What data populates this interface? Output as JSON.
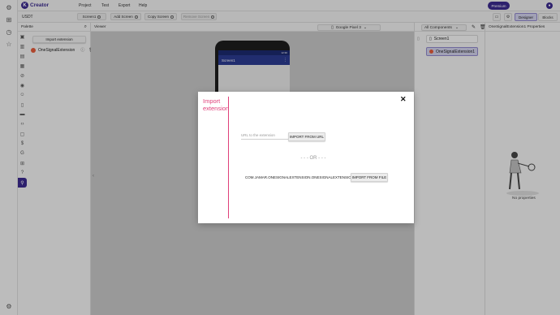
{
  "app": {
    "brand": "Creator",
    "logo_letter": "K",
    "accent": "#3a2a8c"
  },
  "menu": [
    "Project",
    "Test",
    "Export",
    "Help"
  ],
  "premium_label": "Premium",
  "project_name": "USDT",
  "toolbar": {
    "screen_select": "Screen1",
    "add_screen": "Add Screen",
    "copy_screen": "Copy Screen",
    "remove_screen": "Remove Screen",
    "designer": "Designer",
    "blocks": "Blocks"
  },
  "palette": {
    "title": "Palette",
    "import_button": "Import extension",
    "extension_item": "OneSignalExtension"
  },
  "viewer": {
    "title": "Viewer",
    "device": "Google Pixel 3",
    "screen_title": "Screen1",
    "status_time": "12:30"
  },
  "components": {
    "selector": "All Components",
    "items": [
      "Screen1",
      "OneSignalExtension1"
    ]
  },
  "properties": {
    "title": "OneSignalExtension1 Properties",
    "empty_label": "No properties"
  },
  "modal": {
    "title": "Import extension",
    "url_placeholder": "URL to the extension",
    "import_url_button": "IMPORT FROM URL",
    "or_label": "- - - OR - - -",
    "file_name": "COM.JAMAR.ONESIGNALEXTENSION.ONESIGNALEXTENSION.AIX",
    "import_file_button": "IMPORT FROM FILE",
    "title_color": "#e0407a"
  }
}
